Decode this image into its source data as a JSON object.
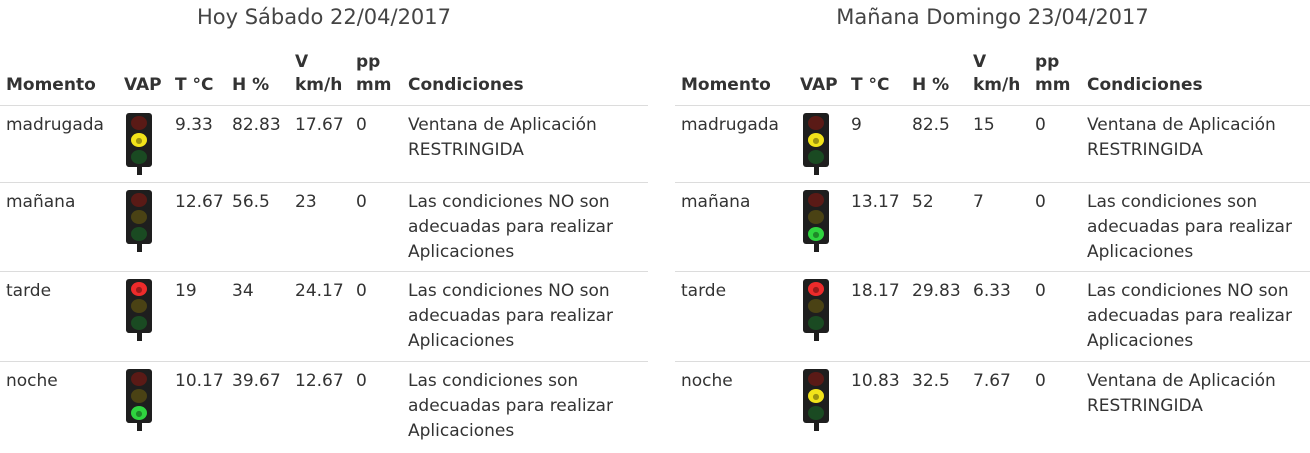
{
  "headers": {
    "momento": "Momento",
    "vap": "VAP",
    "temp": "T °C",
    "hum": "H %",
    "wind_v": "V",
    "wind_unit": "km/h",
    "pp": "pp",
    "pp_unit": "mm",
    "conditions": "Condiciones"
  },
  "light_colors": {
    "off": "#3a3a3a",
    "red": "#ee2b2b",
    "yellow": "#f2e31a",
    "green": "#2fd43f",
    "body": "#1e1e1e"
  },
  "days": [
    {
      "title": "Hoy Sábado 22/04/2017",
      "rows": [
        {
          "momento": "madrugada",
          "light": "yellow",
          "temp": "9.33",
          "hum": "82.83",
          "wind": "17.67",
          "pp": "0",
          "cond": "Ventana de Aplicación RESTRINGIDA"
        },
        {
          "momento": "mañana",
          "light": "none",
          "temp": "12.67",
          "hum": "56.5",
          "wind": "23",
          "pp": "0",
          "cond": "Las condiciones NO son adecuadas para realizar Aplicaciones"
        },
        {
          "momento": "tarde",
          "light": "red",
          "temp": "19",
          "hum": "34",
          "wind": "24.17",
          "pp": "0",
          "cond": "Las condiciones NO son adecuadas para realizar Aplicaciones"
        },
        {
          "momento": "noche",
          "light": "green",
          "temp": "10.17",
          "hum": "39.67",
          "wind": "12.67",
          "pp": "0",
          "cond": "Las condiciones son adecuadas para realizar Aplicaciones"
        }
      ]
    },
    {
      "title": "Mañana Domingo 23/04/2017",
      "rows": [
        {
          "momento": "madrugada",
          "light": "yellow",
          "temp": "9",
          "hum": "82.5",
          "wind": "15",
          "pp": "0",
          "cond": "Ventana de Aplicación RESTRINGIDA"
        },
        {
          "momento": "mañana",
          "light": "green",
          "temp": "13.17",
          "hum": "52",
          "wind": "7",
          "pp": "0",
          "cond": "Las condiciones son adecuadas para realizar Aplicaciones"
        },
        {
          "momento": "tarde",
          "light": "red",
          "temp": "18.17",
          "hum": "29.83",
          "wind": "6.33",
          "pp": "0",
          "cond": "Las condiciones NO son adecuadas para realizar Aplicaciones"
        },
        {
          "momento": "noche",
          "light": "yellow",
          "temp": "10.83",
          "hum": "32.5",
          "wind": "7.67",
          "pp": "0",
          "cond": "Ventana de Aplicación RESTRINGIDA"
        }
      ]
    }
  ]
}
